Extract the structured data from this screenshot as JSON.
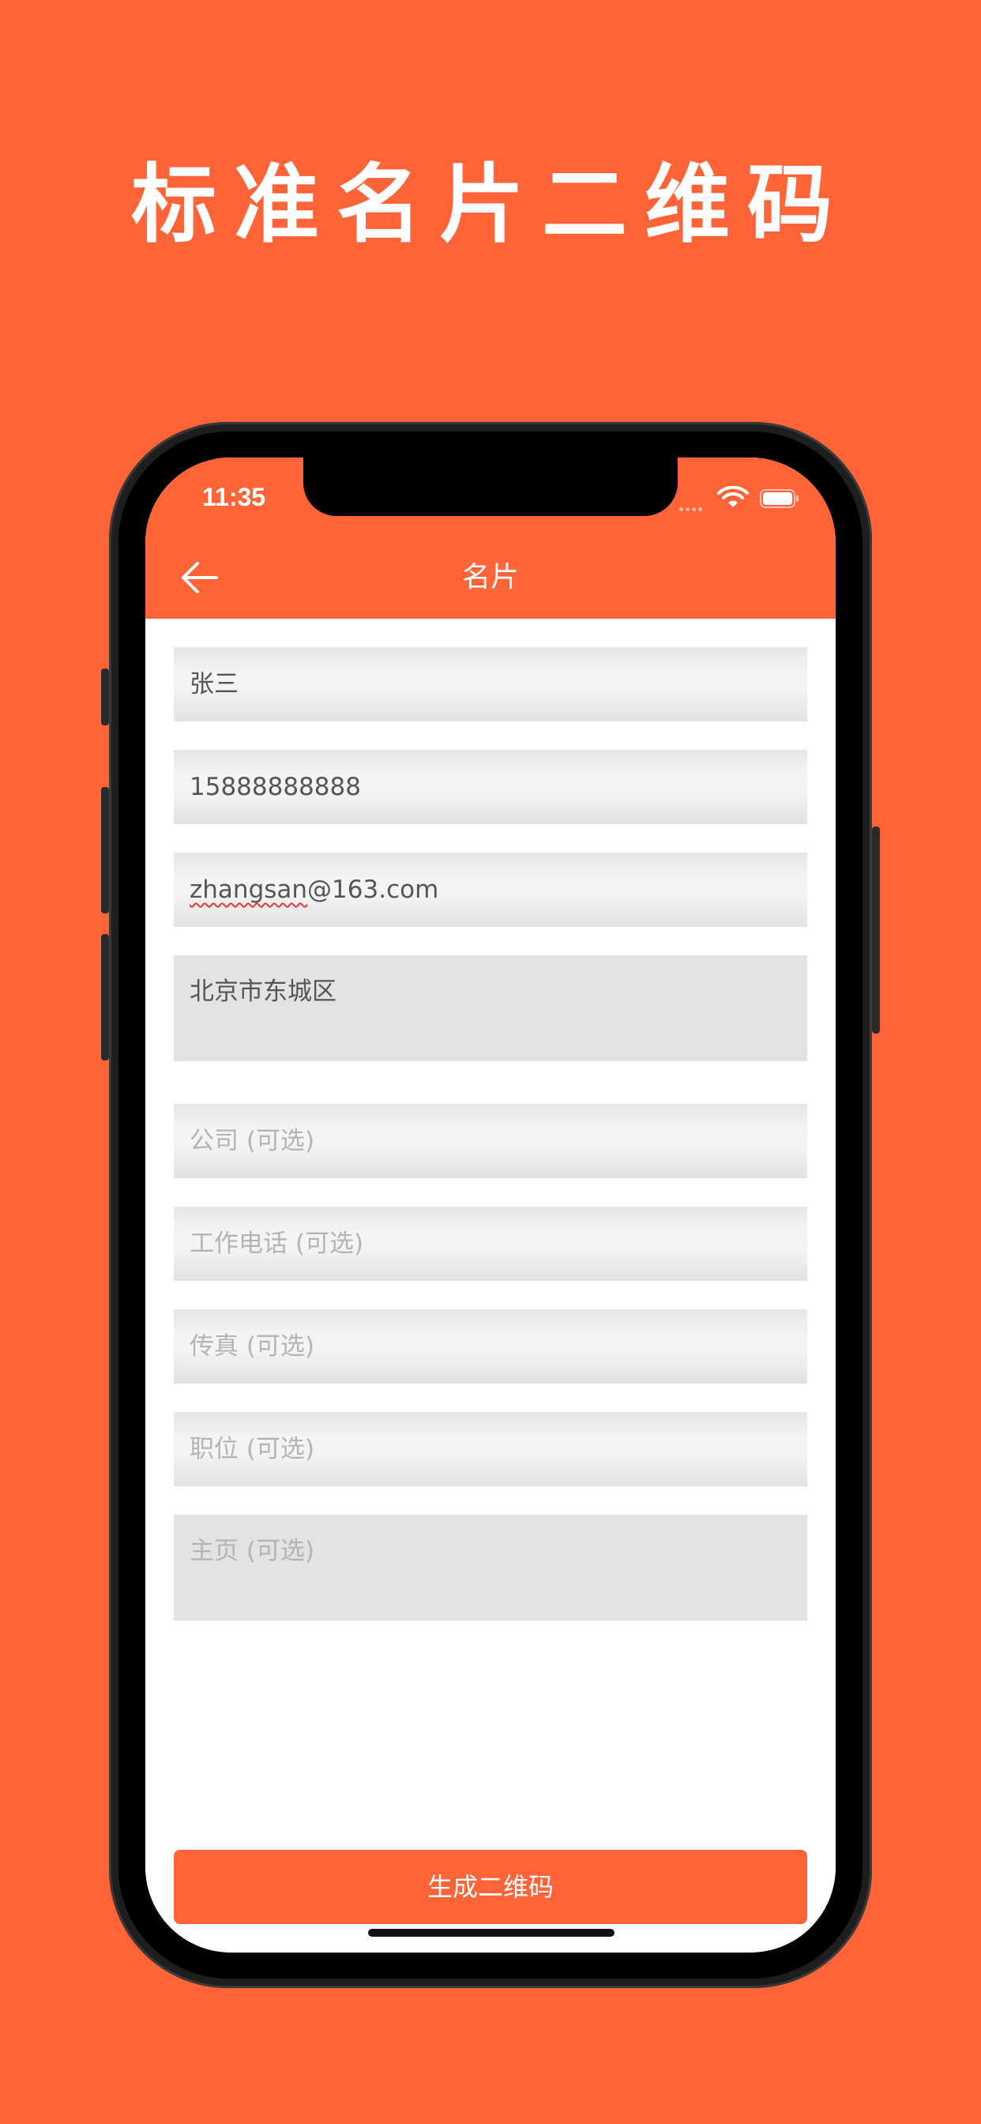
{
  "headline": "标准名片二维码",
  "status_bar": {
    "time": "11:35"
  },
  "nav": {
    "title": "名片"
  },
  "form": {
    "name": {
      "value": "张三"
    },
    "phone": {
      "value": "15888888888"
    },
    "email": {
      "value_misspelled": "zhangsan",
      "value_rest": "@163.com"
    },
    "address": {
      "value": "北京市东城区"
    },
    "company": {
      "placeholder": "公司 (可选)"
    },
    "work_phone": {
      "placeholder": "工作电话 (可选)"
    },
    "fax": {
      "placeholder": "传真 (可选)"
    },
    "position": {
      "placeholder": "职位 (可选)"
    },
    "homepage": {
      "placeholder": "主页 (可选)"
    }
  },
  "submit_label": "生成二维码",
  "colors": {
    "brand": "#FF6338",
    "field_bg": "#E3E3E3",
    "text": "#555555",
    "placeholder": "#B4B4B4"
  },
  "icons": {
    "back": "back-arrow-icon",
    "wifi": "wifi-icon",
    "battery": "battery-icon"
  }
}
